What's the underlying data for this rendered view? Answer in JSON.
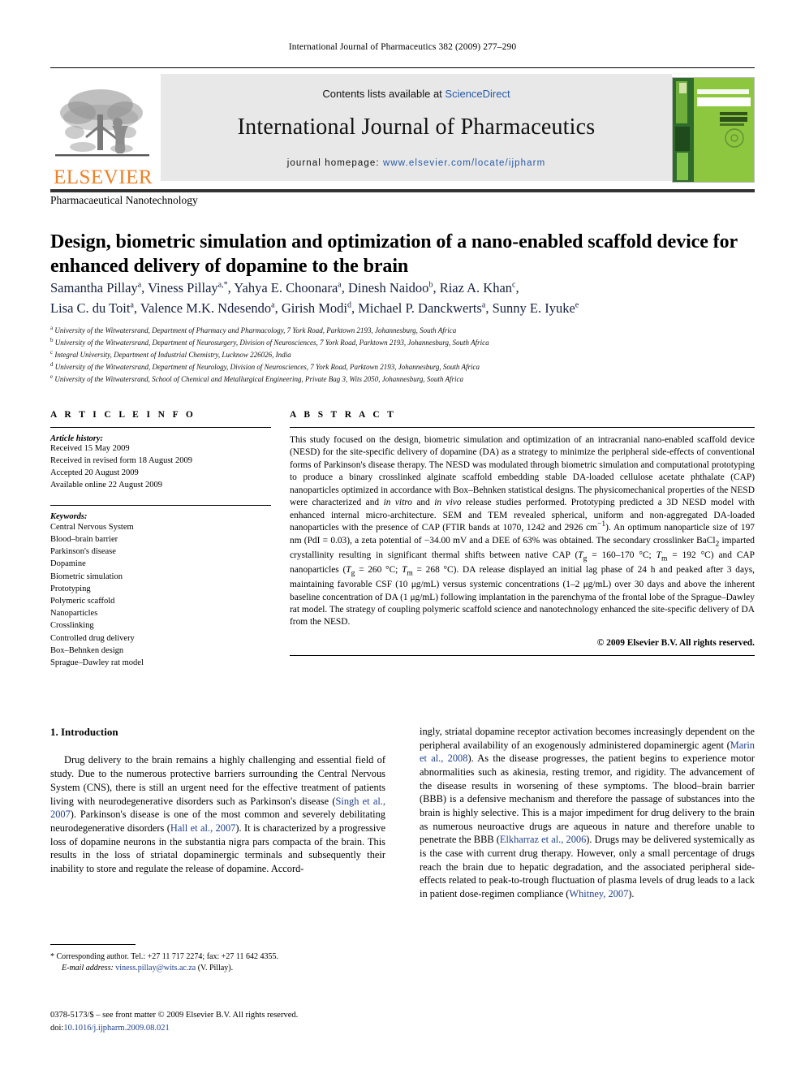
{
  "running_head": "International Journal of Pharmaceutics 382 (2009) 277–290",
  "masthead": {
    "contents_prefix": "Contents lists available at ",
    "sciencedirect": "ScienceDirect",
    "journal_title": "International Journal of Pharmaceutics",
    "homepage_prefix": "journal homepage:",
    "homepage_url": "www.elsevier.com/locate/ijpharm",
    "publisher_wordmark": "ELSEVIER",
    "cover_title_small": "INTERNATIONAL JOURNAL OF",
    "cover_title_big": "PHARMACEUTICS",
    "colors": {
      "link": "#2659a8",
      "elsevier_orange": "#f08024",
      "cover_green": "#8dc63f",
      "band": "#e8e8e8"
    }
  },
  "article": {
    "section_label": "Pharmacaeutical Nanotechnology",
    "title": "Design, biometric simulation and optimization of a nano-enabled scaffold device for enhanced delivery of dopamine to the brain",
    "authors_line1": "Samantha Pillay<sup>a</sup>, Viness Pillay<sup>a,</sup><sup>*</sup>, Yahya E. Choonara<sup>a</sup>, Dinesh Naidoo<sup>b</sup>, Riaz A. Khan<sup>c</sup>,",
    "authors_line2": "Lisa C. du Toit<sup>a</sup>, Valence M.K. Ndesendo<sup>a</sup>, Girish Modi<sup>d</sup>, Michael P. Danckwerts<sup>a</sup>, Sunny E. Iyuke<sup>e</sup>",
    "affiliations": [
      {
        "mark": "a",
        "text": "University of the Witwatersrand, Department of Pharmacy and Pharmacology, 7 York Road, Parktown 2193, Johannesburg, South Africa"
      },
      {
        "mark": "b",
        "text": "University of the Witwatersrand, Department of Neurosurgery, Division of Neurosciences, 7 York Road, Parktown 2193, Johannesburg, South Africa"
      },
      {
        "mark": "c",
        "text": "Integral University, Department of Industrial Chemistry, Lucknow 226026, India"
      },
      {
        "mark": "d",
        "text": "University of the Witwatersrand, Department of Neurology, Division of Neurosciences, 7 York Road, Parktown 2193, Johannesburg, South Africa"
      },
      {
        "mark": "e",
        "text": "University of the Witwatersrand, School of Chemical and Metallurgical Engineering, Private Bag 3, Wits 2050, Johannesburg, South Africa"
      }
    ]
  },
  "article_info": {
    "heading": "A R T I C L E   I N F O",
    "history_title": "Article history:",
    "history": [
      "Received 15 May 2009",
      "Received in revised form 18 August 2009",
      "Accepted 20 August 2009",
      "Available online 22 August 2009"
    ],
    "keywords_title": "Keywords:",
    "keywords": [
      "Central Nervous System",
      "Blood–brain barrier",
      "Parkinson's disease",
      "Dopamine",
      "Biometric simulation",
      "Prototyping",
      "Polymeric scaffold",
      "Nanoparticles",
      "Crosslinking",
      "Controlled drug delivery",
      "Box–Behnken design",
      "Sprague–Dawley rat model"
    ]
  },
  "abstract": {
    "heading": "A B S T R A C T",
    "body": "This study focused on the design, biometric simulation and optimization of an intracranial nano-enabled scaffold device (NESD) for the site-specific delivery of dopamine (DA) as a strategy to minimize the peripheral side-effects of conventional forms of Parkinson's disease therapy. The NESD was modulated through biometric simulation and computational prototyping to produce a binary crosslinked alginate scaffold embedding stable DA-loaded cellulose acetate phthalate (CAP) nanoparticles optimized in accordance with Box–Behnken statistical designs. The physicomechanical properties of the NESD were characterized and in vitro and in vivo release studies performed. Prototyping predicted a 3D NESD model with enhanced internal micro-architecture. SEM and TEM revealed spherical, uniform and non-aggregated DA-loaded nanoparticles with the presence of CAP (FTIR bands at 1070, 1242 and 2926 cm−1). An optimum nanoparticle size of 197 nm (PdI = 0.03), a zeta potential of −34.00 mV and a DEE of 63% was obtained. The secondary crosslinker BaCl2 imparted crystallinity resulting in significant thermal shifts between native CAP (Tg = 160–170 °C; Tm = 192 °C) and CAP nanoparticles (Tg = 260 °C; Tm = 268 °C). DA release displayed an initial lag phase of 24 h and peaked after 3 days, maintaining favorable CSF (10 μg/mL) versus systemic concentrations (1–2 μg/mL) over 30 days and above the inherent baseline concentration of DA (1 μg/mL) following implantation in the parenchyma of the frontal lobe of the Sprague–Dawley rat model. The strategy of coupling polymeric scaffold science and nanotechnology enhanced the site-specific delivery of DA from the NESD.",
    "copyright": "© 2009 Elsevier B.V. All rights reserved."
  },
  "body_text": {
    "intro_heading": "1.  Introduction",
    "left_paragraph": "Drug delivery to the brain remains a highly challenging and essential field of study. Due to the numerous protective barriers surrounding the Central Nervous System (CNS), there is still an urgent need for the effective treatment of patients living with neurodegenerative disorders such as Parkinson's disease (Singh et al., 2007). Parkinson's disease is one of the most common and severely debilitating neurodegenerative disorders (Hall et al., 2007). It is characterized by a progressive loss of dopamine neurons in the substantia nigra pars compacta of the brain. This results in the loss of striatal dopaminergic terminals and subsequently their inability to store and regulate the release of dopamine. Accord-",
    "right_paragraph": "ingly, striatal dopamine receptor activation becomes increasingly dependent on the peripheral availability of an exogenously administered dopaminergic agent (Marin et al., 2008). As the disease progresses, the patient begins to experience motor abnormalities such as akinesia, resting tremor, and rigidity. The advancement of the disease results in worsening of these symptoms. The blood–brain barrier (BBB) is a defensive mechanism and therefore the passage of substances into the brain is highly selective. This is a major impediment for drug delivery to the brain as numerous neuroactive drugs are aqueous in nature and therefore unable to penetrate the BBB (Elkharraz et al., 2006). Drugs may be delivered systemically as is the case with current drug therapy. However, only a small percentage of drugs reach the brain due to hepatic degradation, and the associated peripheral side-effects related to peak-to-trough fluctuation of plasma levels of drug leads to a lack in patient dose-regimen compliance (Whitney, 2007).",
    "citations": [
      "Singh et al., 2007",
      "Hall et al., 2007",
      "Marin et al., 2008",
      "Elkharraz et al., 2006",
      "Whitney, 2007"
    ]
  },
  "footnotes": {
    "corresponding": "* Corresponding author. Tel.: +27 11 717 2274; fax: +27 11 642 4355.",
    "email_label": "E-mail address:",
    "email": "viness.pillay@wits.ac.za",
    "email_suffix": "(V. Pillay).",
    "issn_line": "0378-5173/$ – see front matter © 2009 Elsevier B.V. All rights reserved.",
    "doi_label": "doi:",
    "doi_value": "10.1016/j.ijpharm.2009.08.021"
  }
}
